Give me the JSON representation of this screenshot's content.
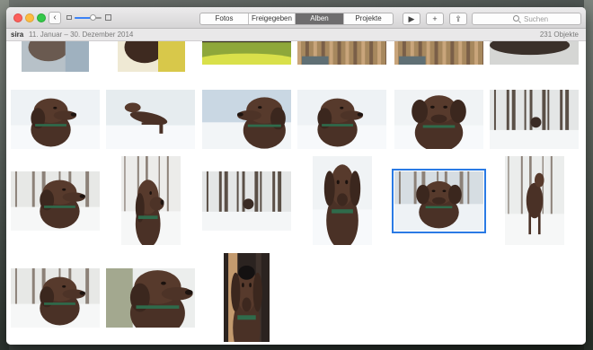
{
  "toolbar": {
    "back_glyph": "‹",
    "tabs": [
      {
        "label": "Fotos",
        "active": false
      },
      {
        "label": "Freigegeben",
        "active": false
      },
      {
        "label": "Alben",
        "active": true
      },
      {
        "label": "Projekte",
        "active": false
      }
    ],
    "play_glyph": "▶",
    "add_glyph": "+",
    "share_glyph": "⇪",
    "search": {
      "placeholder": "Suchen"
    }
  },
  "info": {
    "album_name": "sira",
    "date_range": "11. Januar – 30. Dezember 2014",
    "count": "231 Objekte"
  },
  "colors": {
    "accent": "#2a7ae4",
    "active_tab": "#6e6d6e"
  },
  "photos": [
    {
      "scene": "partial-cool",
      "selected": false
    },
    {
      "scene": "partial-yellow",
      "selected": false
    },
    {
      "scene": "partial-green",
      "selected": false
    },
    {
      "scene": "partial-stripes",
      "selected": false
    },
    {
      "scene": "partial-stripes",
      "selected": false
    },
    {
      "scene": "partial-dark",
      "selected": false
    },
    {
      "scene": "head-snow",
      "selected": false
    },
    {
      "scene": "dog-playbow",
      "selected": false
    },
    {
      "scene": "head-right-sky",
      "selected": false
    },
    {
      "scene": "head-snow",
      "selected": false
    },
    {
      "scene": "head-front",
      "selected": false
    },
    {
      "scene": "forest-small-dog",
      "selected": false
    },
    {
      "scene": "head-forest",
      "selected": false
    },
    {
      "scene": "head-trees",
      "selected": false
    },
    {
      "scene": "forest-small-dog",
      "selected": false
    },
    {
      "scene": "head-front",
      "selected": false
    },
    {
      "scene": "head-front-forest",
      "selected": true
    },
    {
      "scene": "dog-standing",
      "selected": false
    },
    {
      "scene": "head-forest",
      "selected": false
    },
    {
      "scene": "head-profile",
      "selected": false
    },
    {
      "scene": "dark-portrait",
      "selected": false
    }
  ]
}
